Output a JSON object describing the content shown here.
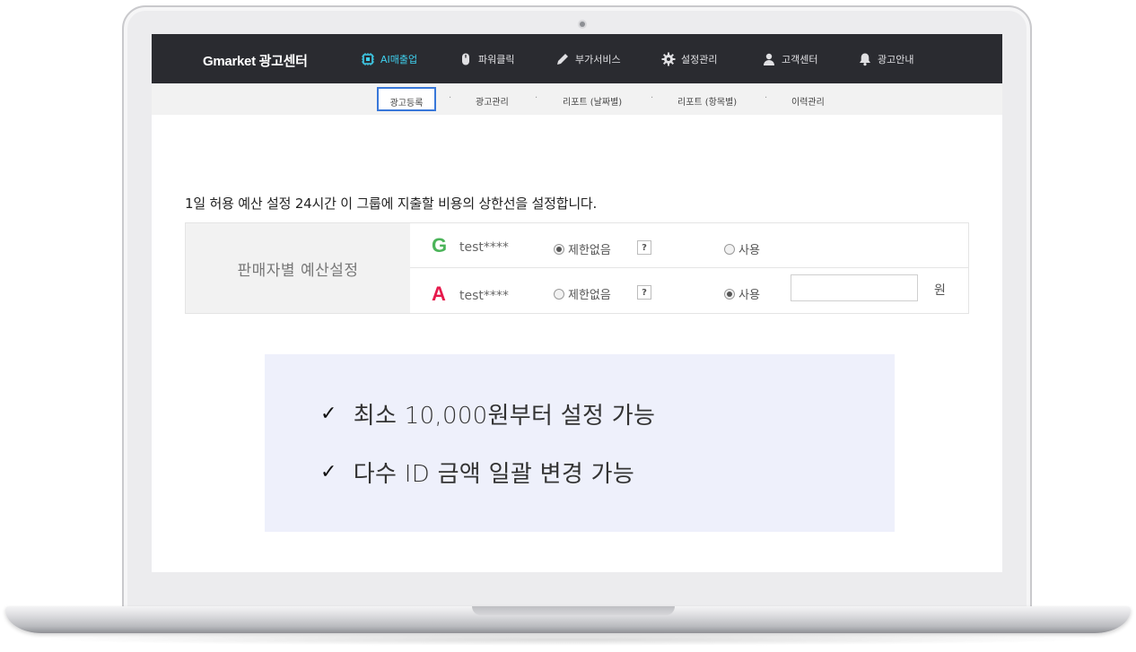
{
  "header": {
    "brand": "Gmarket 광고센터",
    "nav": [
      {
        "label": "AI매출업",
        "icon": "chip-icon",
        "active": true
      },
      {
        "label": "파워클릭",
        "icon": "mouse-icon",
        "active": false
      },
      {
        "label": "부가서비스",
        "icon": "pencil-icon",
        "active": false
      },
      {
        "label": "설정관리",
        "icon": "gear-icon",
        "active": false
      },
      {
        "label": "고객센터",
        "icon": "user-icon",
        "active": false
      },
      {
        "label": "광고안내",
        "icon": "bell-icon",
        "active": false
      }
    ]
  },
  "subnav": {
    "items": [
      {
        "label": "광고등록",
        "active": true
      },
      {
        "label": "광고관리"
      },
      {
        "label": "리포트 (날짜별)"
      },
      {
        "label": "리포트 (항목별)"
      },
      {
        "label": "이력관리"
      }
    ],
    "separator": "·"
  },
  "content": {
    "description": "1일 허용 예산 설정 24시간 이 그룹에 지출할 비용의 상한선을 설정합니다.",
    "table": {
      "header": "판매자별 예산설정",
      "rows": [
        {
          "site_letter": "G",
          "site_color": "#4cb45a",
          "seller_id": "test****",
          "option_unlimited": "제한없음",
          "option_use": "사용",
          "selected": "unlimited",
          "help": "?"
        },
        {
          "site_letter": "A",
          "site_color": "#e6194b",
          "seller_id": "test****",
          "option_unlimited": "제한없음",
          "option_use": "사용",
          "selected": "use",
          "help": "?",
          "amount": "",
          "unit": "원"
        }
      ]
    }
  },
  "info": {
    "check_mark": "✓",
    "lines": [
      "최소 10,000원부터 설정 가능",
      "다수 ID 금액 일괄 변경 가능"
    ]
  },
  "colors": {
    "nav_bg": "#2a2b30",
    "nav_active": "#3fd0ee",
    "subnav_active_border": "#3877d9",
    "info_bg": "#eef0fb"
  }
}
